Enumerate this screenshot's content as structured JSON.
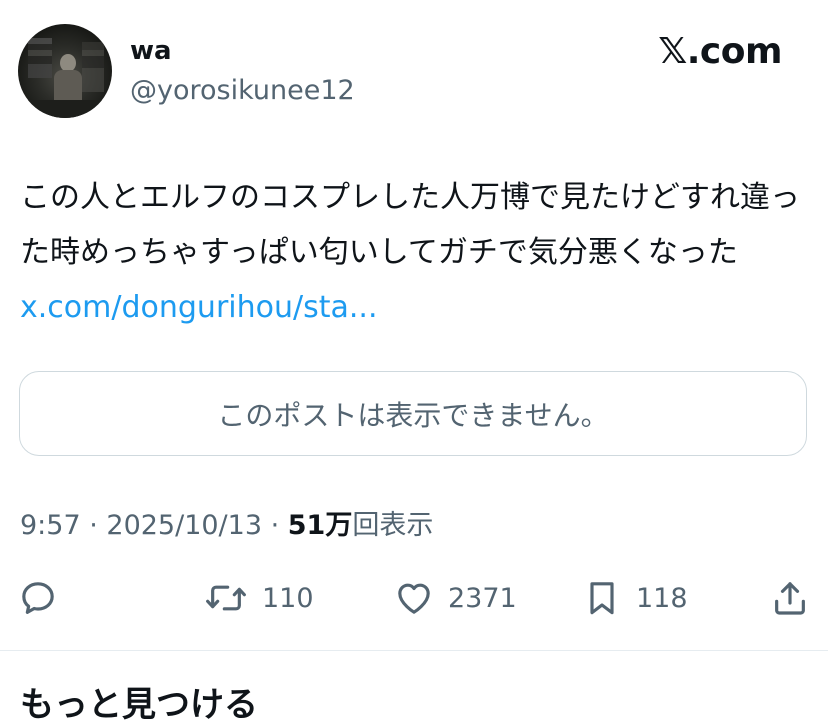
{
  "author": {
    "display_name": "wa",
    "handle": "@yorosikunee12"
  },
  "brand_label": "𝕏.com",
  "tweet": {
    "text": "この人とエルフのコスプレした人万博で見たけどすれ違った時めっちゃすっぱい匂いしてガチで気分悪くなった ",
    "link_text": "x.com/dongurihou/sta..."
  },
  "quoted_post": {
    "message": "このポストは表示できません。"
  },
  "meta": {
    "time": "9:57",
    "separator": " · ",
    "date": "2025/10/13",
    "views_count": "51万",
    "views_label": "回表示"
  },
  "actions": {
    "reply": {
      "icon": "reply-icon",
      "count": ""
    },
    "retweet": {
      "icon": "retweet-icon",
      "count": "110"
    },
    "like": {
      "icon": "heart-icon",
      "count": "2371"
    },
    "bookmark": {
      "icon": "bookmark-icon",
      "count": "118"
    },
    "share": {
      "icon": "share-icon",
      "count": ""
    }
  },
  "section_heading": "もっと見つける",
  "colors": {
    "link": "#1d9bf0",
    "secondary_text": "#536471",
    "border": "#cfd9de"
  }
}
